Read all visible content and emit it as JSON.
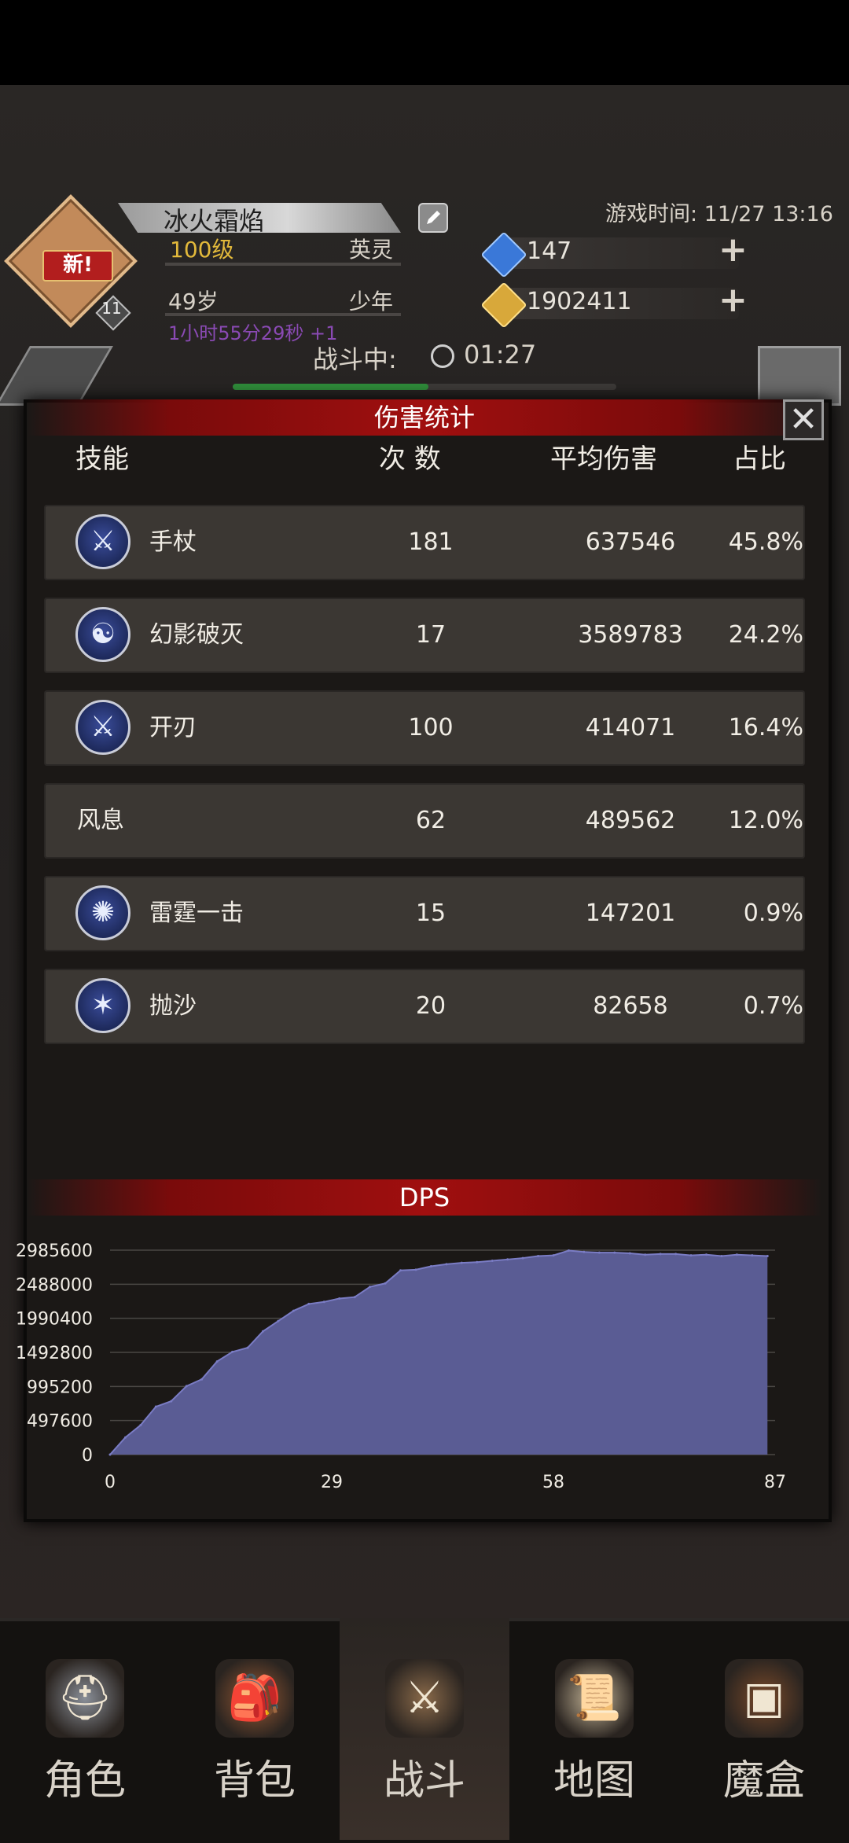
{
  "header": {
    "avatar_badge": "新!",
    "level_number": "11",
    "player_name": "冰火霜焰",
    "level": "100级",
    "rank": "英灵",
    "age": "49岁",
    "stage": "少年",
    "online_timer": "1小时55分29秒 +1",
    "game_time": "游戏时间: 11/27 13:16",
    "gems": "147",
    "gold": "1902411",
    "plus_symbol": "+",
    "battle_label": "战斗中:",
    "battle_time": "01:27",
    "battle_progress": 0.51
  },
  "damage_stats": {
    "title": "伤害统计",
    "close_symbol": "✕",
    "columns": [
      "技能",
      "次 数",
      "平均伤害",
      "占比"
    ],
    "rows": [
      {
        "icon": "staff-icon",
        "name": "手杖",
        "count": "181",
        "avg": "637546",
        "pct": "45.8%"
      },
      {
        "icon": "phantom-icon",
        "name": "幻影破灭",
        "count": "17",
        "avg": "3589783",
        "pct": "24.2%"
      },
      {
        "icon": "blade-icon",
        "name": "开刃",
        "count": "100",
        "avg": "414071",
        "pct": "16.4%"
      },
      {
        "icon": "",
        "name": "风息",
        "count": "62",
        "avg": "489562",
        "pct": "12.0%"
      },
      {
        "icon": "thunder-icon",
        "name": "雷霆一击",
        "count": "15",
        "avg": "147201",
        "pct": "0.9%"
      },
      {
        "icon": "sand-icon",
        "name": "抛沙",
        "count": "20",
        "avg": "82658",
        "pct": "0.7%"
      }
    ]
  },
  "chart_data": {
    "type": "area",
    "title": "DPS",
    "xlabel": "",
    "ylabel": "",
    "x_ticks": [
      "0",
      "29",
      "58",
      "87"
    ],
    "y_ticks": [
      "2985600",
      "2488000",
      "1990400",
      "1492800",
      "995200",
      "497600",
      "0"
    ],
    "xlim": [
      0,
      87
    ],
    "ylim": [
      0,
      2985600
    ],
    "grid": true,
    "fill_color": "#5a5c94",
    "x": [
      0,
      2,
      4,
      6,
      8,
      10,
      12,
      14,
      16,
      18,
      20,
      22,
      24,
      26,
      28,
      30,
      32,
      34,
      36,
      38,
      40,
      42,
      44,
      46,
      48,
      50,
      52,
      54,
      56,
      58,
      60,
      62,
      64,
      66,
      68,
      70,
      72,
      74,
      76,
      78,
      80,
      82,
      84,
      86
    ],
    "values": [
      0,
      250000,
      430000,
      700000,
      780000,
      1000000,
      1100000,
      1360000,
      1500000,
      1560000,
      1800000,
      1950000,
      2100000,
      2200000,
      2230000,
      2280000,
      2300000,
      2450000,
      2500000,
      2690000,
      2700000,
      2750000,
      2780000,
      2800000,
      2810000,
      2830000,
      2850000,
      2870000,
      2900000,
      2910000,
      2980000,
      2960000,
      2950000,
      2950000,
      2940000,
      2920000,
      2930000,
      2930000,
      2910000,
      2920000,
      2900000,
      2920000,
      2910000,
      2900000
    ]
  },
  "nav": {
    "items": [
      {
        "label": "角色",
        "icon": "helmet-icon"
      },
      {
        "label": "背包",
        "icon": "backpack-icon"
      },
      {
        "label": "战斗",
        "icon": "shield-sword-icon"
      },
      {
        "label": "地图",
        "icon": "scroll-map-icon"
      },
      {
        "label": "魔盒",
        "icon": "magic-box-icon"
      }
    ],
    "active_index": 2
  }
}
